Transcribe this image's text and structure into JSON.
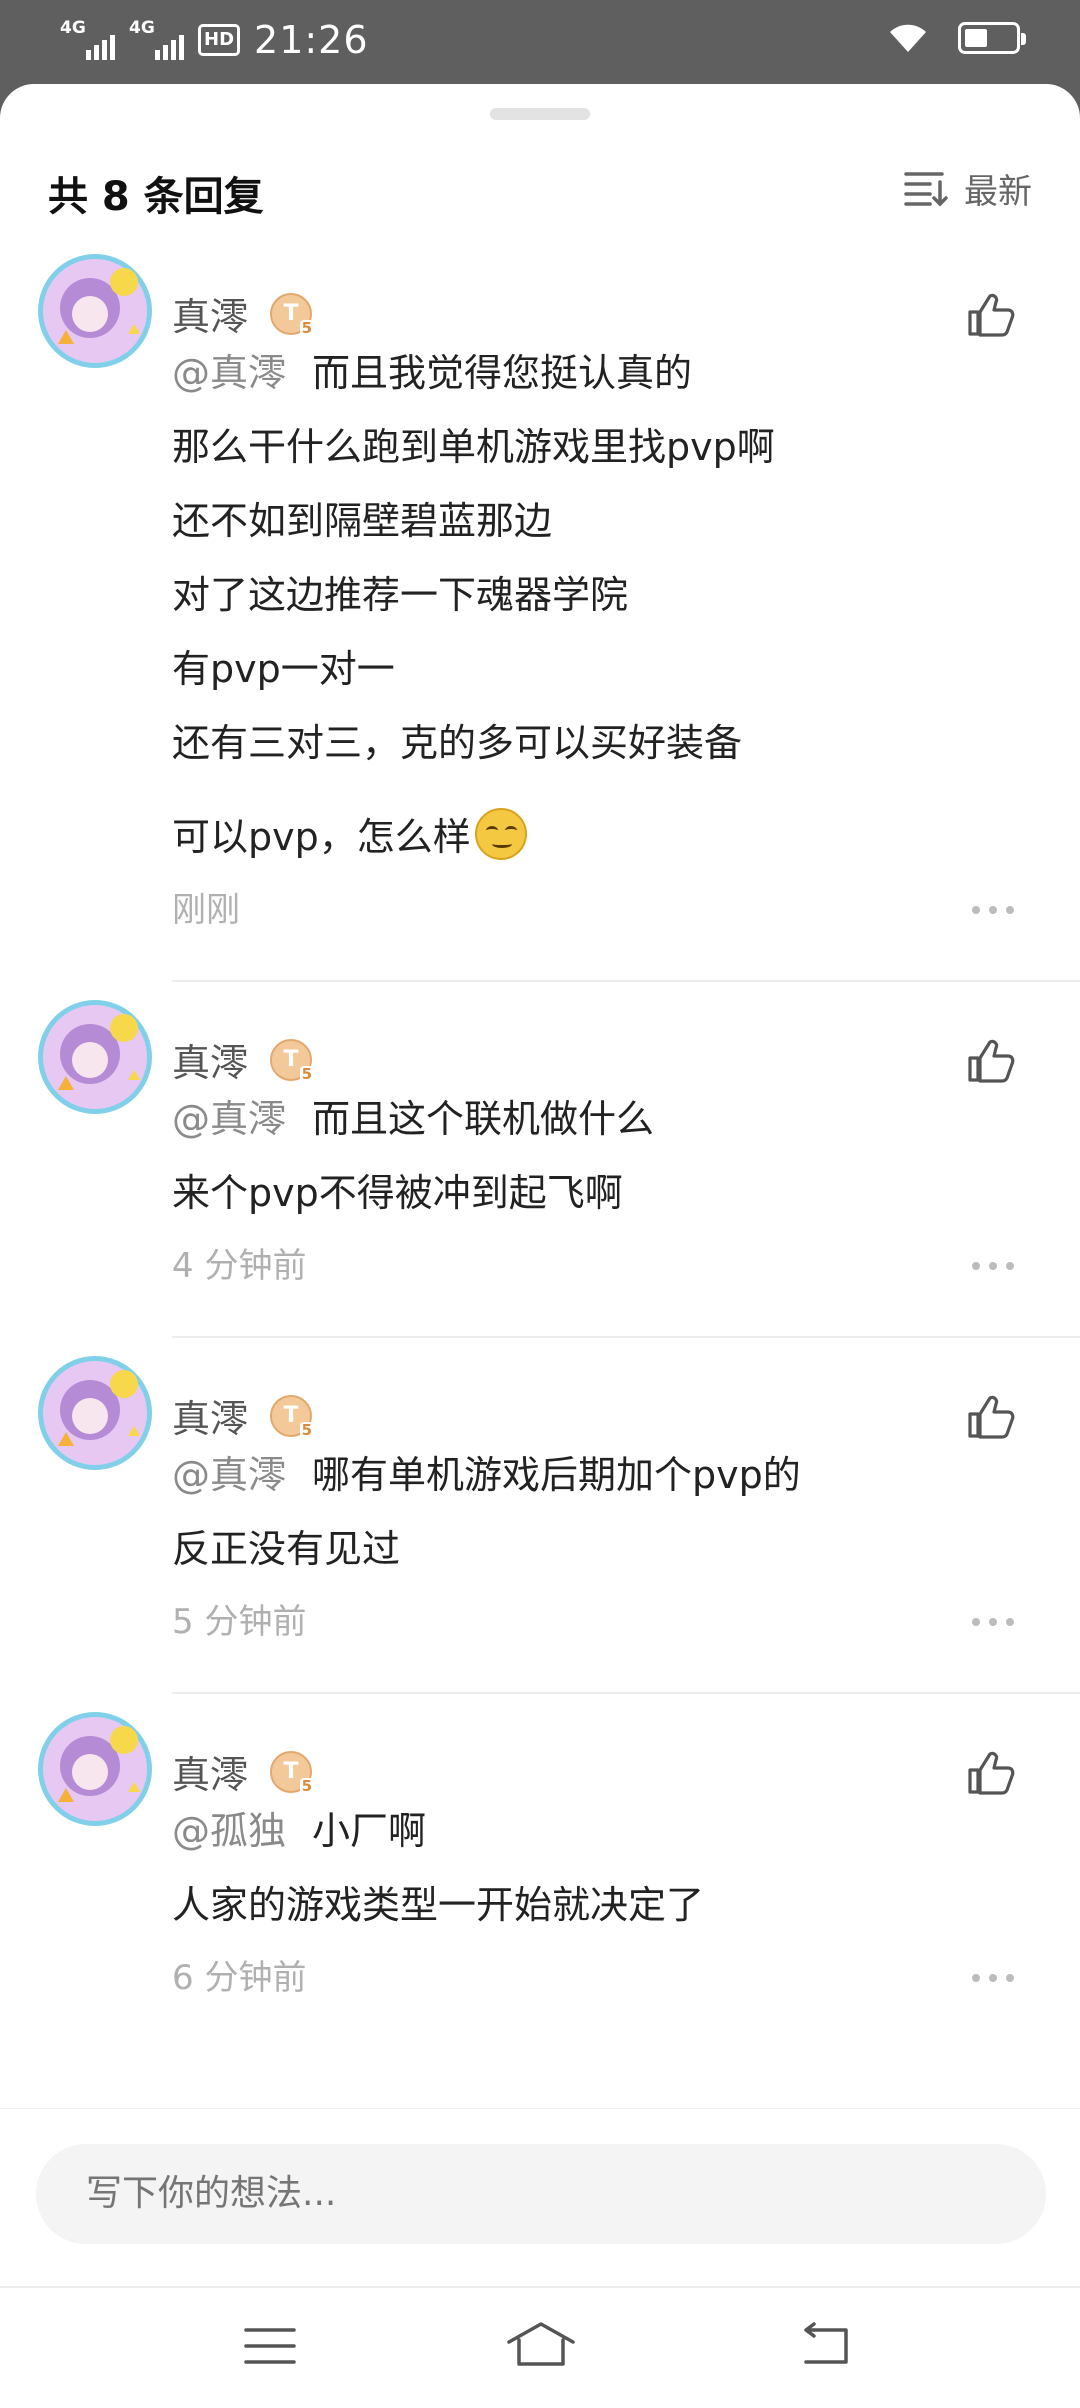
{
  "status_bar": {
    "signal1_label": "4G",
    "signal2_label": "4G",
    "hd_label": "HD",
    "time": "21:26",
    "battery_level": 0.4
  },
  "header": {
    "reply_count": "共 8 条回复",
    "sort_label": "最新",
    "sort_icon": "sort-lines-icon"
  },
  "comments": [
    {
      "author": "真澪",
      "level": "T",
      "level_sub": "5",
      "mention": "@真澪",
      "lines": [
        "而且我觉得您挺认真的",
        "那么干什么跑到单机游戏里找pvp啊",
        "还不如到隔壁碧蓝那边",
        "对了这边推荐一下魂器学院",
        "有pvp一对一",
        "还有三对三，克的多可以买好装备",
        "可以pvp，怎么样"
      ],
      "emoji": "smirk-emoji",
      "time": "刚刚"
    },
    {
      "author": "真澪",
      "level": "T",
      "level_sub": "5",
      "mention": "@真澪",
      "lines": [
        "而且这个联机做什么",
        "来个pvp不得被冲到起飞啊"
      ],
      "time": "4 分钟前"
    },
    {
      "author": "真澪",
      "level": "T",
      "level_sub": "5",
      "mention": "@真澪",
      "lines": [
        "哪有单机游戏后期加个pvp的",
        "反正没有见过"
      ],
      "time": "5 分钟前"
    },
    {
      "author": "真澪",
      "level": "T",
      "level_sub": "5",
      "mention": "@孤独",
      "lines": [
        "小厂啊",
        "人家的游戏类型一开始就决定了"
      ],
      "time": "6 分钟前"
    }
  ],
  "input": {
    "placeholder": "写下你的想法..."
  },
  "nav": {
    "menu_icon": "menu-icon",
    "home_icon": "home-icon",
    "back_icon": "back-icon"
  }
}
